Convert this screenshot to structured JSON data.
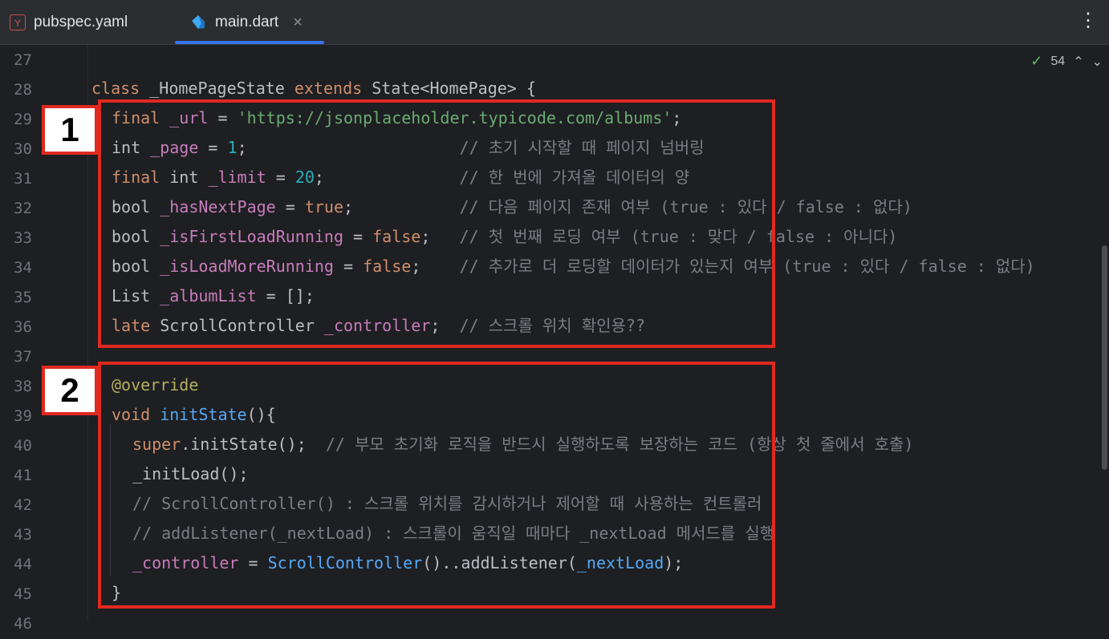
{
  "tabs": [
    {
      "label": "pubspec.yaml",
      "icon": "yaml-file-icon",
      "icon_text": "Y"
    },
    {
      "label": "main.dart",
      "icon": "dart-file-icon",
      "close": "×"
    }
  ],
  "more_menu": "⋮",
  "inspection": {
    "count": "54",
    "check": "✓",
    "up": "⌃",
    "down": "⌄"
  },
  "line_numbers": [
    "27",
    "28",
    "29",
    "30",
    "31",
    "32",
    "33",
    "34",
    "35",
    "36",
    "37",
    "38",
    "39",
    "40",
    "41",
    "42",
    "43",
    "44",
    "45",
    "46"
  ],
  "code": {
    "l28": {
      "kw1": "class",
      "name": " _HomePageState ",
      "kw2": "extends",
      "rest": " State<HomePage> {"
    },
    "l29": {
      "kw": "final",
      "sp": " ",
      "fld": "_url",
      "eq": " = ",
      "str": "'https://jsonplaceholder.typicode.com/albums'",
      "end": ";"
    },
    "l30": {
      "ty": "int ",
      "fld": "_page",
      "eq": " = ",
      "num": "1",
      "end": ";",
      "pad": "                      ",
      "cmt": "// 초기 시작할 때 페이지 넘버링"
    },
    "l31": {
      "kw": "final",
      "ty": " int ",
      "fld": "_limit",
      "eq": " = ",
      "num": "20",
      "end": ";",
      "pad": "              ",
      "cmt": "// 한 번에 가져올 데이터의 양"
    },
    "l32": {
      "ty": "bool ",
      "fld": "_hasNextPage",
      "eq": " = ",
      "kw": "true",
      "end": ";",
      "pad": "           ",
      "cmt": "// 다음 페이지 존재 여부 (true : 있다 / false : 없다)"
    },
    "l33": {
      "ty": "bool ",
      "fld": "_isFirstLoadRunning",
      "eq": " = ",
      "kw": "false",
      "end": ";",
      "pad": "   ",
      "cmt": "// 첫 번째 로딩 여부 (true : 맞다 / false : 아니다)"
    },
    "l34": {
      "ty": "bool ",
      "fld": "_isLoadMoreRunning",
      "eq": " = ",
      "kw": "false",
      "end": ";",
      "pad": "    ",
      "cmt": "// 추가로 더 로딩할 데이터가 있는지 여부 (true : 있다 / false : 없다)"
    },
    "l35": {
      "ty": "List ",
      "fld": "_albumList",
      "rest": " = [];"
    },
    "l36": {
      "kw": "late",
      "ty": " ScrollController ",
      "fld": "_controller",
      "end": ";",
      "pad": "  ",
      "cmt": "// 스크롤 위치 확인용??"
    },
    "l38": {
      "ann": "@override"
    },
    "l39": {
      "kw": "void",
      "sp": " ",
      "fn": "initState",
      "rest": "(){"
    },
    "l40": {
      "kw": "super",
      "rest": ".initState();",
      "pad": "  ",
      "cmt": "// 부모 초기화 로직을 반드시 실행하도록 보장하는 코드 (항상 첫 줄에서 호출)"
    },
    "l41": {
      "rest": "_initLoad();"
    },
    "l42": {
      "cmt": "// ScrollController() : 스크롤 위치를 감시하거나 제어할 때 사용하는 컨트롤러"
    },
    "l43": {
      "cmt": "// addListener(_nextLoad) : 스크롤이 움직일 때마다 _nextLoad 메서드를 실행"
    },
    "l44": {
      "fld": "_controller",
      "eq": " = ",
      "fn": "ScrollController",
      "mid": "()..addListener(",
      "fld2": "_nextLoad",
      "end": ");"
    },
    "l45": {
      "rest": "}"
    }
  },
  "annotations": [
    {
      "label": "1",
      "color": "#e0291f"
    },
    {
      "label": "2",
      "color": "#e0291f"
    }
  ]
}
